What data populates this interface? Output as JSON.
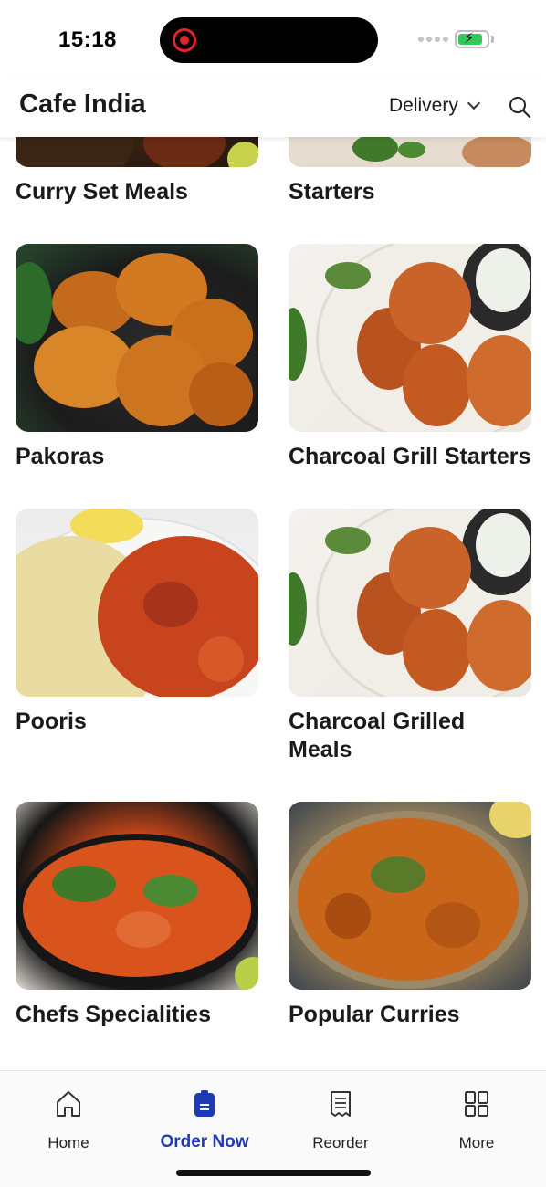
{
  "status_bar": {
    "time": "15:18"
  },
  "header": {
    "title": "Cafe India",
    "delivery_label": "Delivery"
  },
  "categories": [
    {
      "label": "Curry Set Meals"
    },
    {
      "label": "Starters"
    },
    {
      "label": "Pakoras"
    },
    {
      "label": "Charcoal Grill Starters"
    },
    {
      "label": "Pooris"
    },
    {
      "label": "Charcoal Grilled Meals"
    },
    {
      "label": "Chefs Specialities"
    },
    {
      "label": "Popular Curries"
    }
  ],
  "bottom_nav": {
    "items": [
      {
        "label": "Home",
        "icon": "home-icon"
      },
      {
        "label": "Order Now",
        "icon": "order-icon"
      },
      {
        "label": "Reorder",
        "icon": "receipt-icon"
      },
      {
        "label": "More",
        "icon": "grid-icon"
      }
    ],
    "active_color": "#1f3bb3"
  }
}
